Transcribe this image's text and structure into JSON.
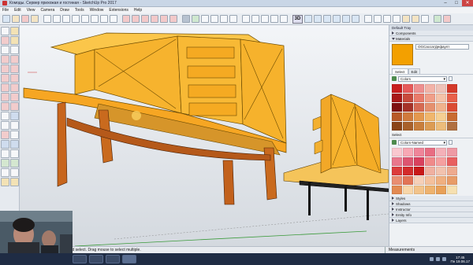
{
  "window": {
    "title": "Комоды. Сервер прихожая и гостиная - SketchUp Pro 2017",
    "controls": [
      "–",
      "□",
      "✕"
    ]
  },
  "menu": [
    "File",
    "Edit",
    "View",
    "Camera",
    "Draw",
    "Tools",
    "Window",
    "Extensions",
    "Help"
  ],
  "toolbar": {
    "view_3d_label": "3D"
  },
  "status": {
    "hint": "xtend select. Drag mouse to select multiple.",
    "measurements_label": "Measurements"
  },
  "tray": {
    "title": "Default Tray",
    "panels_top": [
      {
        "label": "Components",
        "state": "collapsed"
      },
      {
        "label": "Materials",
        "state": "expanded"
      }
    ],
    "material_name": "OGСассатДефаулт",
    "material_color": "#f3a000",
    "tabs": [
      "Select",
      "Edit"
    ],
    "active_tab": "Select",
    "collection_1": "Colors",
    "select_label": "Select",
    "collection_2": "Colors-Named",
    "palette_1": [
      "#c81e1e",
      "#e65a5a",
      "#ee8f8f",
      "#f2b3a8",
      "#eec2b8",
      "#d43a2a",
      "#a81818",
      "#c84a3c",
      "#e97a6a",
      "#f09e88",
      "#f4c2a8",
      "#e8604a",
      "#7e1010",
      "#a63228",
      "#d66a52",
      "#e5906e",
      "#f0b28c",
      "#db4c34",
      "#b85a28",
      "#d07a3c",
      "#e4984e",
      "#f0b66c",
      "#f5cf92",
      "#c86b30",
      "#8a4418",
      "#a8602a",
      "#c87e3c",
      "#dc9c54",
      "#ecbc7a",
      "#b07040"
    ],
    "palette_2": [
      "#f9c7cf",
      "#f7a8b4",
      "#ef8599",
      "#e86d82",
      "#f4b0b8",
      "#ee9aa4",
      "#e9778c",
      "#dd5570",
      "#d9415e",
      "#f08a8a",
      "#f5a0a0",
      "#e86060",
      "#dc3c3c",
      "#d32a2a",
      "#c81818",
      "#f0b0a0",
      "#f2c2ae",
      "#eeaa8e",
      "#e98e72",
      "#e27456",
      "#f6d0b8",
      "#f4c09c",
      "#f0b080",
      "#e89c68",
      "#e38a52",
      "#f8d6a8",
      "#f2c38a",
      "#eeb26e",
      "#e8a058",
      "#f6e0b0"
    ],
    "panels_bottom": [
      "Styles",
      "Shadows",
      "Instructor",
      "Entity Info",
      "Layers"
    ]
  },
  "taskbar": {
    "time": "17:45",
    "date": "Пн 19.06.17"
  }
}
